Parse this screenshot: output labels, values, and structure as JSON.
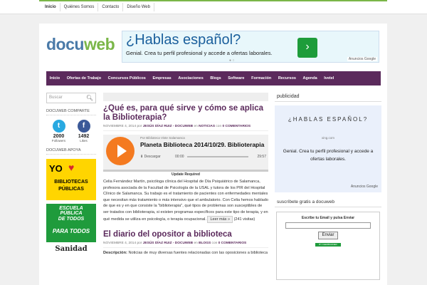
{
  "top_nav": [
    "Inicio",
    "Quiénes Somos",
    "Contacto",
    "Diseño Web"
  ],
  "logo": {
    "part1": "docu",
    "part2": "web"
  },
  "ad_banner": {
    "headline": "¿Hablas español?",
    "subtext": "Genial. Crea tu perfil profesional y accede a ofertas laborales.",
    "arrow": "›",
    "dots": "● ○",
    "google_label": "Anuncios Google"
  },
  "main_nav": [
    "Inicio",
    "Ofertas de Trabajo",
    "Concursos Públicos",
    "Empresas",
    "Asociaciones",
    "Blogs",
    "Software",
    "Formación",
    "Recursos",
    "Agenda",
    "Ivetel"
  ],
  "sidebar": {
    "search_placeholder": "Buscar",
    "comparte_title": "DOCUWEB COMPARTE",
    "twitter": {
      "icon": "t",
      "count": "2000",
      "label": "Followers"
    },
    "facebook": {
      "icon": "f",
      "count": "1492",
      "label": "Likes"
    },
    "apoya_title": "DOCUWEB APOYA",
    "banner1": {
      "yo": "YO",
      "heart": "♥",
      "line1": "BIBLIOTECAS",
      "line2": "PÚBLICAS"
    },
    "banner2": {
      "line1": "ESCUELA PÚBLICA",
      "line2": "DE TODOS",
      "line3": "PARA TODOS"
    },
    "banner3": "Sanidad"
  },
  "post1": {
    "title": "¿Qué es, para qué sirve y cómo se aplica la Biblioterapia?",
    "date": "NOVIEMBRE 4, 2014",
    "by": "por",
    "author": "JESÚS DÍAZ RUIZ - DOCUWEB",
    "in": "en",
    "category": "NOTICIAS",
    "con": "con",
    "comments": "0 COMENTARIOS",
    "player": {
      "by_line": "Por Biblioteca Viste Salamanca",
      "title": "Planeta Biblioteca 2014/10/29. Biblioterapia",
      "download": "⬇ Descargar",
      "time_start": "00:00",
      "time_end": "29:57"
    },
    "update_notice": "Update Required",
    "excerpt": "Celia Fernández Martín, psicóloga clínica del Hospital de Día Psiquiátrico de Salamanca, profesora asociada de la Facultad de Psicología de la USAL y tutora de los PIR del Hospital Clínico de Salamanca. Su trabajo es el tratamiento de pacientes con enfermedades mentales que necesitan más tratamiento o más intensivo que el ambulatorio. Con Celia hemos hablado de que es y en que consiste la \"biblioterapia\", qué tipos de problemas son susceptibles de ser tratados con biblioterapia, si existen programas específicos para este tipo de terapia, y en qué medida se utiliza en psicología, o terapia ocupacional.",
    "read_more": "Leer más »",
    "visits": "(241 visitas)"
  },
  "post2": {
    "title": "El diario del opositor a biblioteca",
    "date": "NOVIEMBRE 4, 2014",
    "by": "por",
    "author": "JESÚS DÍAZ RUIZ - DOCUWEB",
    "in": "en",
    "category": "BLOGS",
    "con": "con",
    "comments": "0 COMENTARIOS",
    "desc_label": "Descripción:",
    "desc": "Noticias de muy diversas fuentes relacionadas con las oposiciones a biblioteca"
  },
  "right": {
    "publicidad": "publicidad",
    "ad": {
      "headline": "¿HABLAS ESPAÑOL?",
      "site": "xing.com",
      "desc": "Genial. Crea tu perfil profesional y accede a ofertas laborales.",
      "google_label": "Anuncios Google"
    },
    "subscribe_title": "suscríbete gratis a docuweb",
    "subscribe_label": "Escribe tu Email y pulsa Enviar",
    "send_button": "Enviar",
    "feed_label": "BY FEEDBURNER"
  },
  "colors": {
    "nav": "#5b2a5c",
    "accent_green": "#7ab648",
    "logo_blue": "#4a7aa8",
    "play_orange": "#f47a20"
  }
}
